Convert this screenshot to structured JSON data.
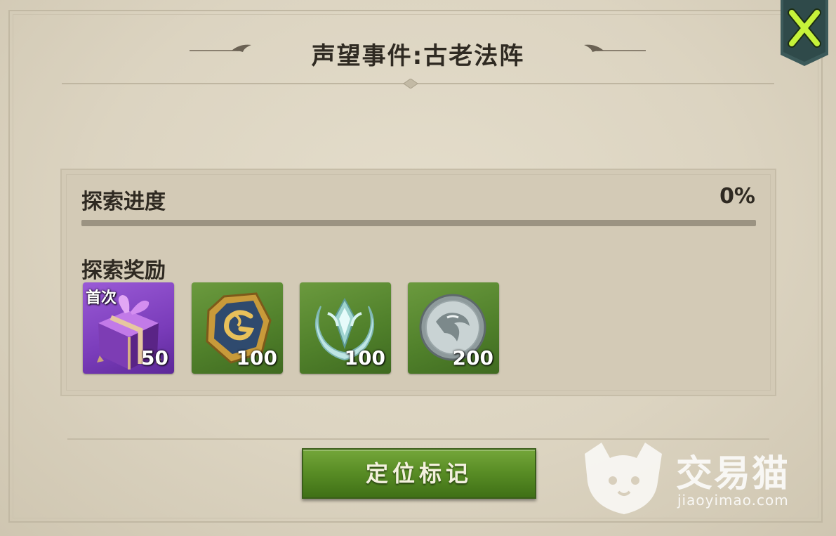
{
  "dialog": {
    "title": "声望事件:古老法阵"
  },
  "progress": {
    "label": "探索进度",
    "value_text": "0%",
    "fraction": 0.0
  },
  "rewards": {
    "label": "探索奖励",
    "items": [
      {
        "icon": "gift-box-icon",
        "tag": "首次",
        "count": "50"
      },
      {
        "icon": "gold-badge-icon",
        "count": "100"
      },
      {
        "icon": "crest-emblem-icon",
        "count": "100"
      },
      {
        "icon": "silver-coin-icon",
        "count": "200"
      }
    ]
  },
  "actions": {
    "locate_label": "定位标记"
  },
  "watermark": {
    "name_cn": "交易猫",
    "site": "jiaoyimao.com"
  },
  "colors": {
    "accent_green": "#5a8e26",
    "close_icon": "#c6f23a",
    "panel_bg": "#dcd4c1"
  }
}
